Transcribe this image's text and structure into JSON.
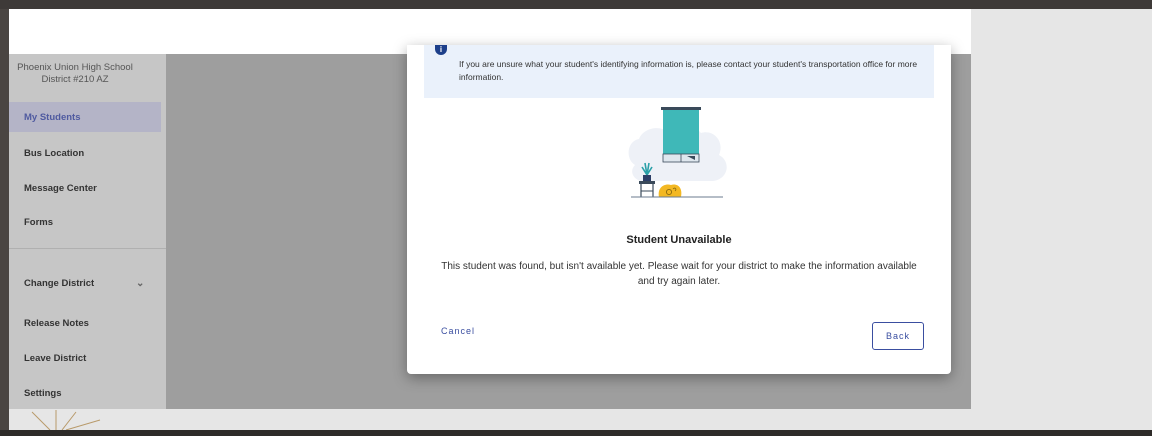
{
  "sidebar": {
    "district_line1": "Phoenix Union High School",
    "district_line2": "District #210 AZ",
    "items": [
      {
        "label": "My Students"
      },
      {
        "label": "Bus Location"
      },
      {
        "label": "Message Center"
      },
      {
        "label": "Forms"
      },
      {
        "label": "Change District"
      },
      {
        "label": "Release Notes"
      },
      {
        "label": "Leave District"
      },
      {
        "label": "Settings"
      }
    ]
  },
  "dialog": {
    "info_text": "If you are unsure what your student's identifying information is, please contact your student's transportation office for more information.",
    "title": "Student Unavailable",
    "body": "This student was found, but isn't available yet. Please wait for your district to make the information available and try again later.",
    "cancel_label": "Cancel",
    "back_label": "Back"
  },
  "colors": {
    "accent": "#3a4ea0",
    "info_bg": "#eaf1fb",
    "active_nav_bg": "#b4b4c7"
  }
}
